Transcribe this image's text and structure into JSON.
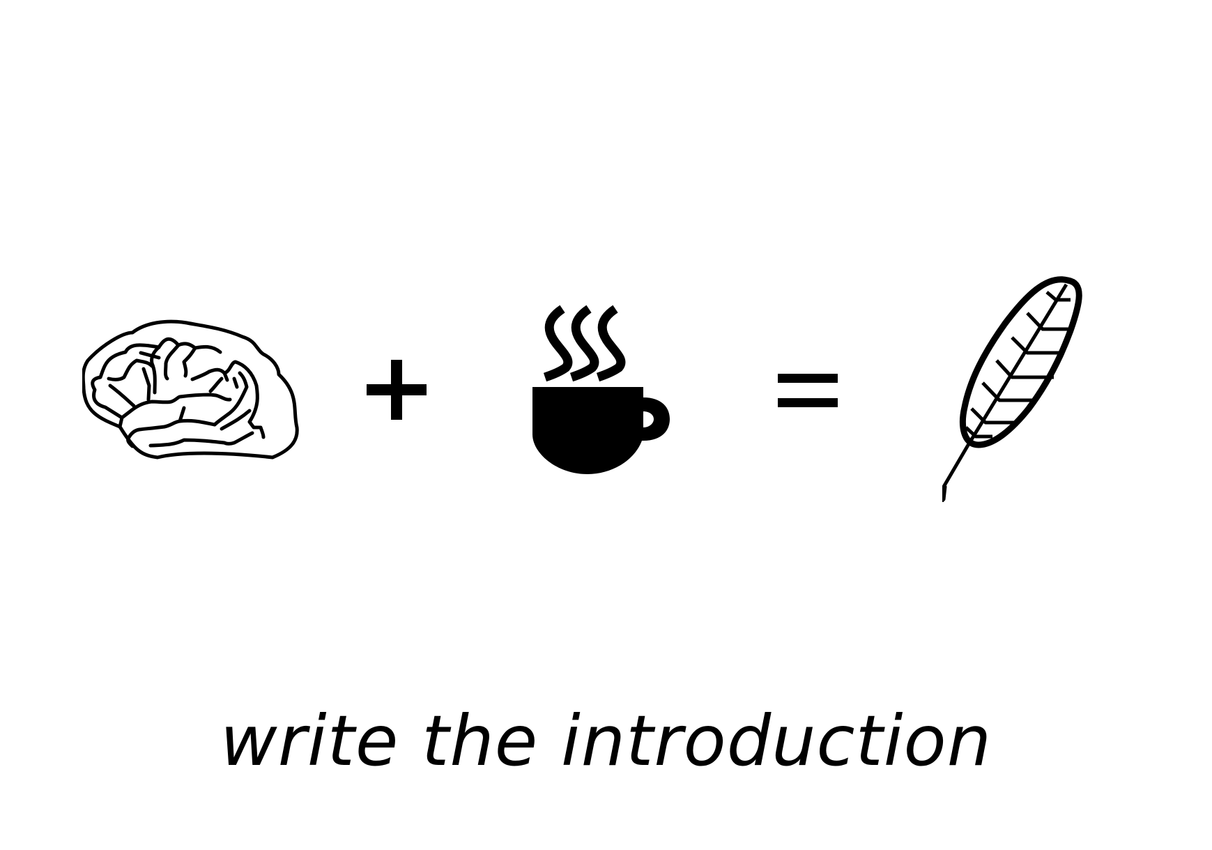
{
  "caption": "write the introduction",
  "icons": [
    "brain-icon",
    "plus-icon",
    "coffee-icon",
    "equals-icon",
    "quill-icon"
  ],
  "colors": {
    "background": "#ffffff",
    "ink": "#000000"
  }
}
